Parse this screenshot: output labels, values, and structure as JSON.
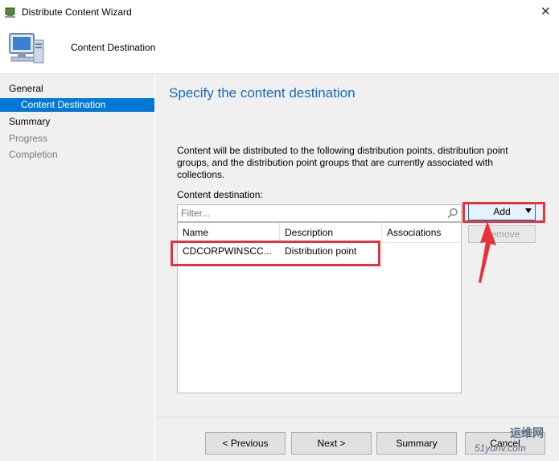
{
  "window": {
    "title": "Distribute Content Wizard",
    "close_glyph": "✕"
  },
  "header": {
    "step_title": "Content Destination"
  },
  "sidebar": {
    "items": [
      {
        "label": "General",
        "state": "normal"
      },
      {
        "label": "Content Destination",
        "state": "active"
      },
      {
        "label": "Summary",
        "state": "normal"
      },
      {
        "label": "Progress",
        "state": "disabled"
      },
      {
        "label": "Completion",
        "state": "disabled"
      }
    ]
  },
  "main": {
    "heading": "Specify the content destination",
    "description": "Content will be distributed to the following distribution points, distribution point groups, and the distribution point groups that are currently associated with collections.",
    "dest_label": "Content destination:",
    "filter_placeholder": "Filter...",
    "columns": [
      "Name",
      "Description",
      "Associations"
    ],
    "rows": [
      {
        "name": "CDCORPWINSCC...",
        "description": "Distribution point",
        "associations": ""
      }
    ],
    "add_label": "Add",
    "remove_label": "Remove"
  },
  "footer": {
    "previous_label": "< Previous",
    "next_label": "Next >",
    "summary_label": "Summary",
    "cancel_label": "Cancel"
  },
  "watermark": {
    "text": "运维网",
    "url": "51yunv.com"
  },
  "colors": {
    "accent": "#0078d7",
    "heading": "#1a6bb5",
    "annotation": "#e5323c"
  }
}
